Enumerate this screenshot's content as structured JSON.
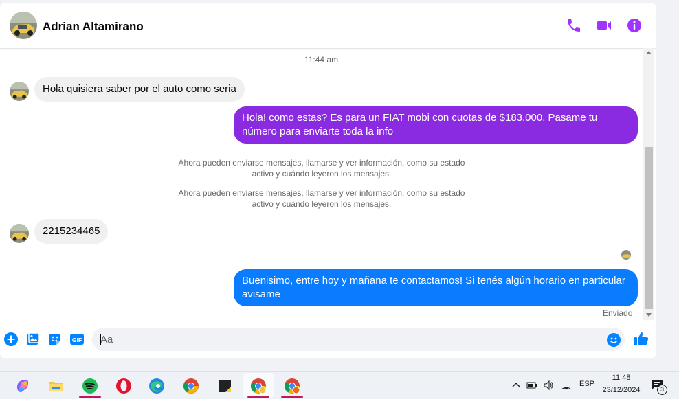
{
  "header": {
    "contact_name": "Adrian Altamirano",
    "actions": [
      "phone-icon",
      "video-camera-icon",
      "info-icon"
    ]
  },
  "conversation": {
    "timestamp": "11:44 am",
    "messages": [
      {
        "direction": "incoming",
        "text": "Hola quisiera saber por el auto como seria"
      },
      {
        "direction": "outgoing",
        "text": "Hola! como estas? Es para un FIAT mobi con cuotas de $183.000. Pasame tu número para enviarte toda la info",
        "color": "#8a2be2"
      },
      {
        "direction": "system",
        "text": "Ahora pueden enviarse mensajes, llamarse y ver información, como su estado activo y cuándo leyeron los mensajes."
      },
      {
        "direction": "system",
        "text": "Ahora pueden enviarse mensajes, llamarse y ver información, como su estado activo y cuándo leyeron los mensajes."
      },
      {
        "direction": "incoming",
        "text": "2215234465"
      },
      {
        "direction": "outgoing",
        "text": "Buenisimo, entre hoy y mañana te contactamos! Si tenés algún horario en particular avisame",
        "color": "#0a7cff"
      }
    ],
    "sent_status": "Enviado"
  },
  "composer": {
    "placeholder": "Aa",
    "actions": [
      "add-icon",
      "image-icon",
      "sticker-icon",
      "gif-icon"
    ],
    "gif_label": "GIF"
  },
  "taskbar": {
    "apps": [
      "copilot",
      "file-explorer",
      "spotify",
      "opera",
      "edge",
      "chrome",
      "sticky-notes",
      "chrome-profile-1",
      "chrome-profile-2"
    ],
    "language": "ESP",
    "time": "11:48",
    "date": "23/12/2024",
    "notification_count": "3"
  },
  "colors": {
    "accent_purple": "#a033ff",
    "outgoing_purple": "#8a2be2",
    "outgoing_blue": "#0a7cff",
    "composer_blue": "#0084ff"
  }
}
